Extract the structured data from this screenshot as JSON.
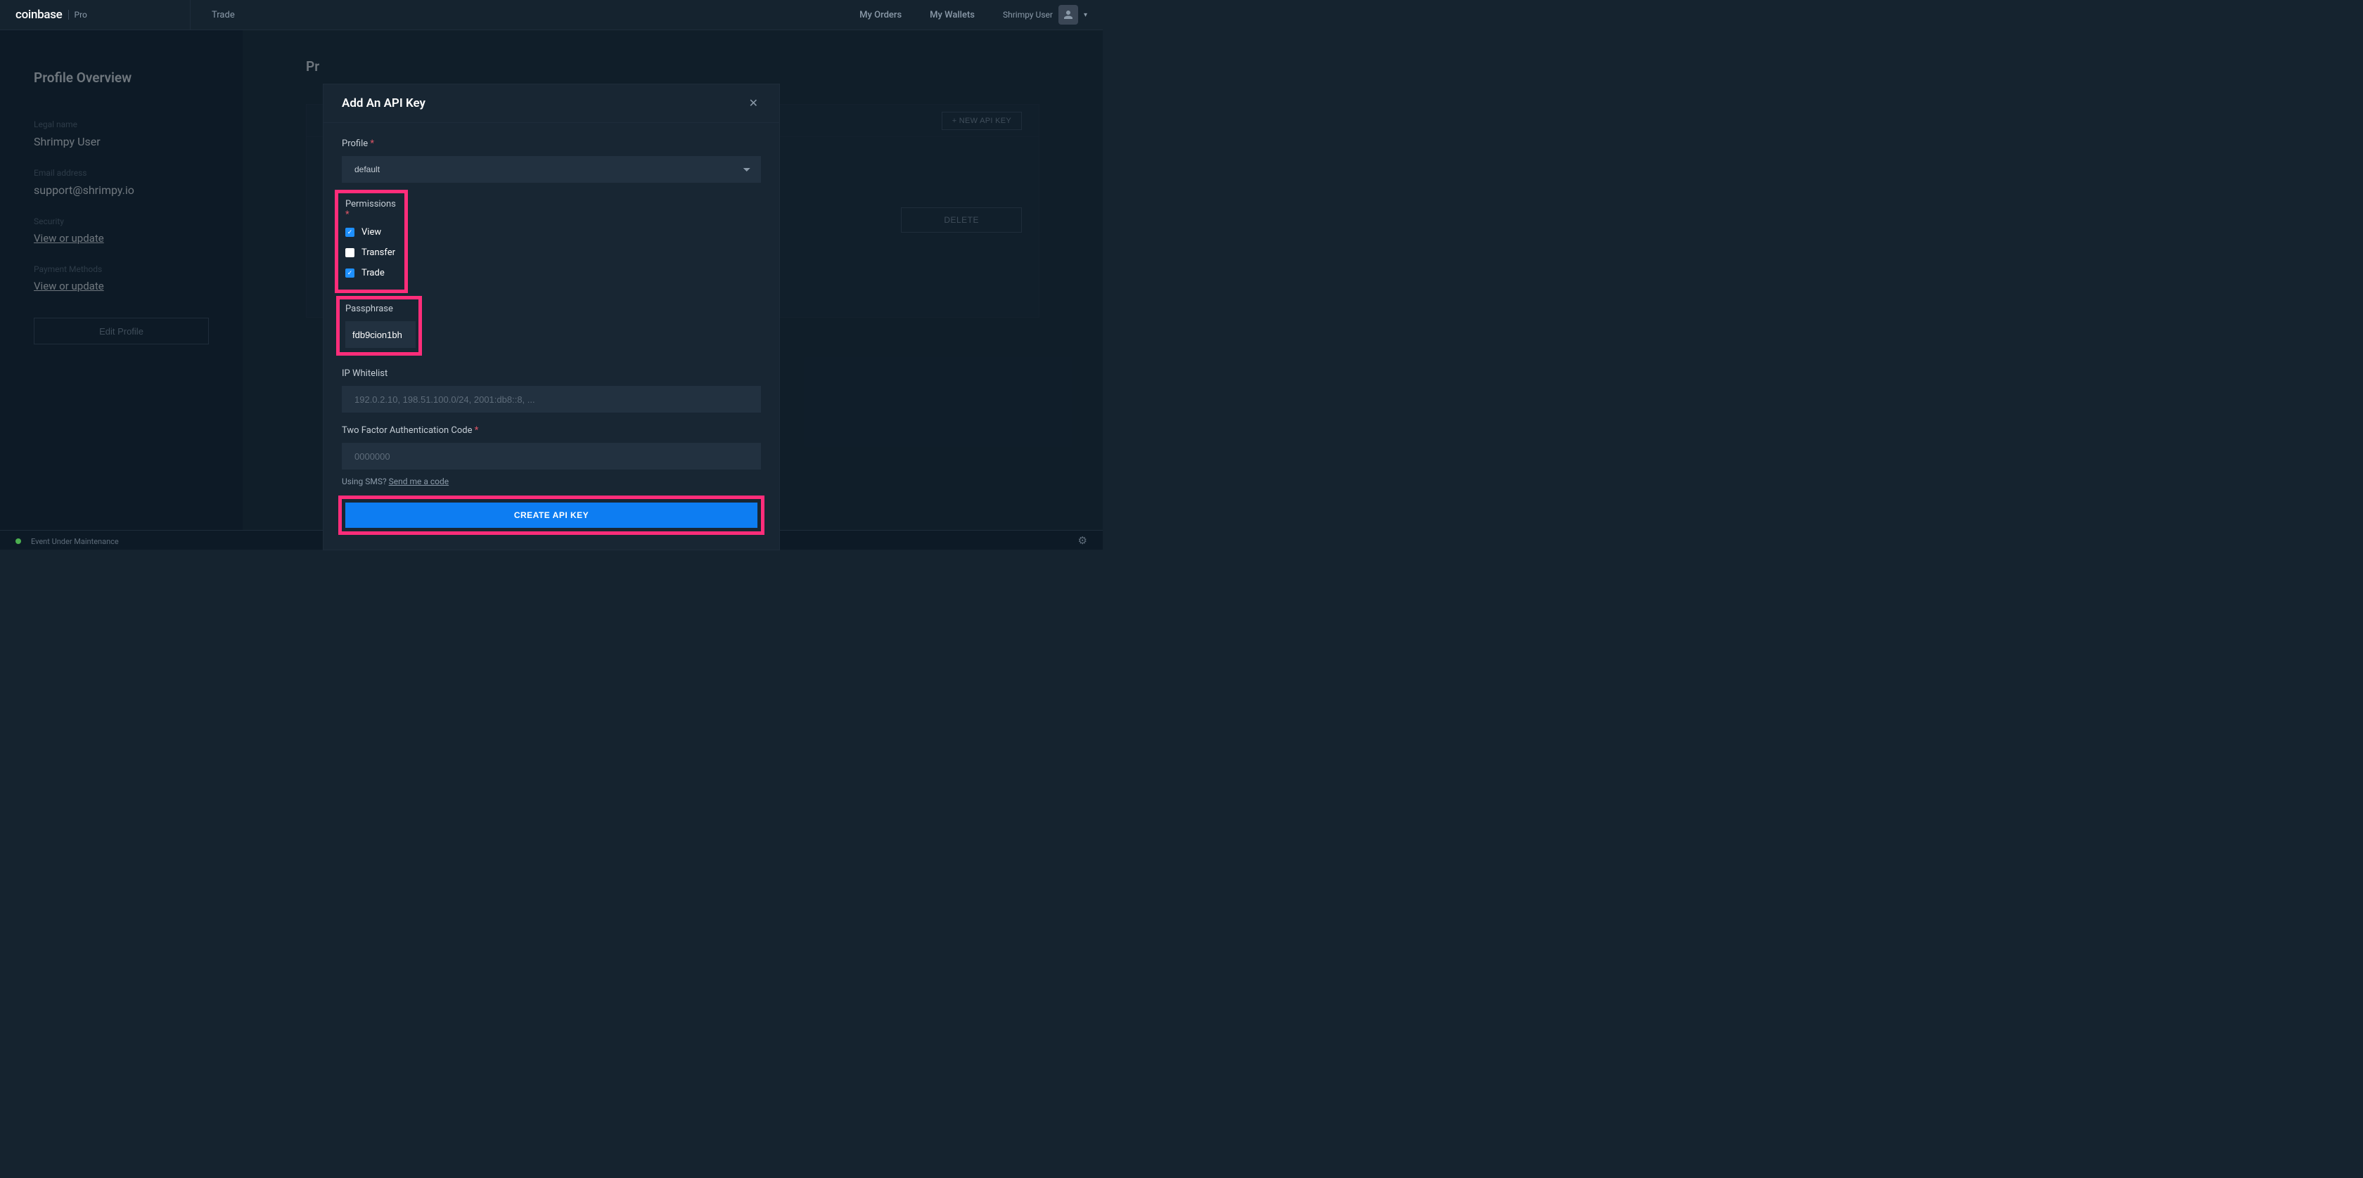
{
  "header": {
    "logo": "coinbase",
    "logo_suffix": "Pro",
    "trade_link": "Trade",
    "my_orders": "My Orders",
    "my_wallets": "My Wallets",
    "username": "Shrimpy User"
  },
  "sidebar": {
    "title": "Profile Overview",
    "legal_name_label": "Legal name",
    "legal_name_value": "Shrimpy User",
    "email_label": "Email address",
    "email_value": "support@shrimpy.io",
    "security_label": "Security",
    "security_link": "View or update",
    "payment_label": "Payment Methods",
    "payment_link": "View or update",
    "edit_profile_btn": "Edit Profile"
  },
  "content": {
    "title_prefix": "Pr",
    "new_api_btn": "+ NEW API KEY",
    "delete_btn": "DELETE"
  },
  "modal": {
    "title": "Add An API Key",
    "profile_label": "Profile",
    "profile_value": "default",
    "permissions_label": "Permissions",
    "perm_view": "View",
    "perm_transfer": "Transfer",
    "perm_trade": "Trade",
    "perm_view_checked": true,
    "perm_transfer_checked": false,
    "perm_trade_checked": true,
    "passphrase_label": "Passphrase",
    "passphrase_value": "fdb9cion1bh",
    "ip_label": "IP Whitelist",
    "ip_placeholder": "192.0.2.10, 198.51.100.0/24, 2001:db8::8, ...",
    "tfa_label": "Two Factor Authentication Code",
    "tfa_placeholder": "0000000",
    "sms_text": "Using SMS? ",
    "sms_link": "Send me a code",
    "create_btn": "CREATE API KEY"
  },
  "footer": {
    "status": "Event Under Maintenance"
  }
}
